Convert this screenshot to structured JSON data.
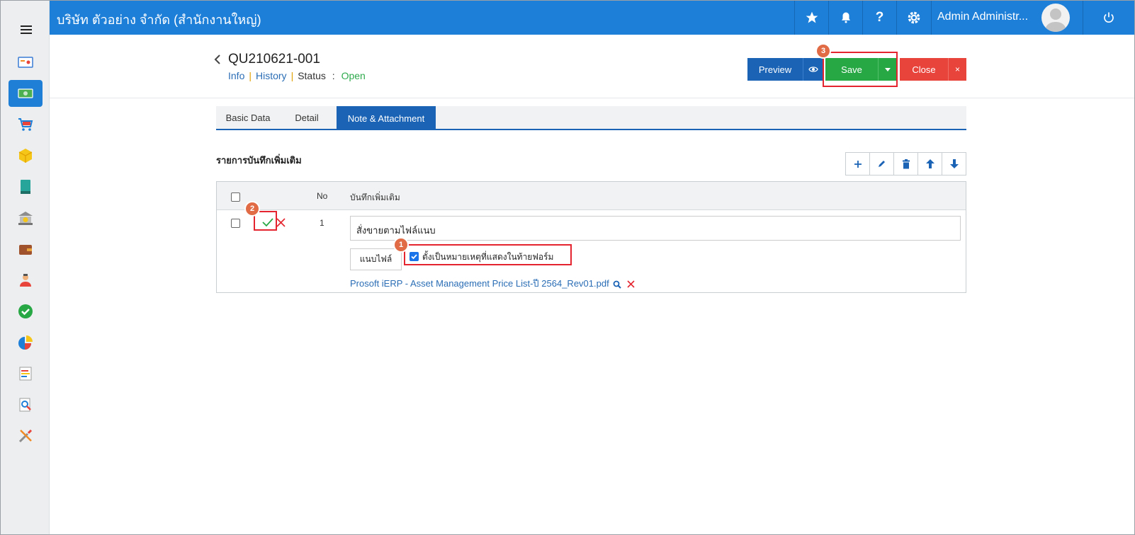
{
  "topbar": {
    "company": "บริษัท ตัวอย่าง จำกัด (สำนักงานใหญ่)",
    "user_name": "Admin Administr...",
    "icons": [
      "star-icon",
      "bell-icon",
      "help-icon",
      "gear-icon",
      "power-icon"
    ]
  },
  "sidebar": {
    "items": [
      "dashboard-icon",
      "money-icon",
      "cart-icon",
      "box-icon",
      "book-icon",
      "bank-icon",
      "wallet-icon",
      "people-icon",
      "check-icon",
      "pie-chart-icon",
      "report-icon",
      "search-doc-icon",
      "tools-icon"
    ],
    "active_index": 1
  },
  "document": {
    "number": "QU210621-001",
    "info_link": "Info",
    "history_link": "History",
    "status_label": "Status",
    "status_colon": ":",
    "status_value": "Open"
  },
  "actions": {
    "preview": "Preview",
    "save": "Save",
    "close": "Close",
    "close_x": "×"
  },
  "steps": {
    "one": "1",
    "two": "2",
    "three": "3"
  },
  "tabs": [
    "Basic Data",
    "Detail",
    "Note & Attachment"
  ],
  "active_tab": 2,
  "section": {
    "title": "รายการบันทึกเพิ่มเติม"
  },
  "grid": {
    "headers": {
      "no": "No",
      "note": "บันทึกเพิ่มเติม"
    },
    "rows": [
      {
        "no": "1",
        "note": "สั่งขายตามไฟล์แนบ",
        "attach_button": "แนบไฟล์",
        "remark_checkbox_label": "ตั้งเป็นหมายเหตุที่แสดงในท้ายฟอร์ม",
        "remark_checked": true,
        "file_name": "Prosoft iERP - Asset Management Price List-ปี 2564_Rev01.pdf"
      }
    ]
  },
  "colors": {
    "topbar": "#1d7fd8",
    "primary": "#1a63b5",
    "save": "#28a745",
    "close": "#e8443b",
    "highlight": "#e4242e",
    "step_badge": "#e06b45"
  }
}
